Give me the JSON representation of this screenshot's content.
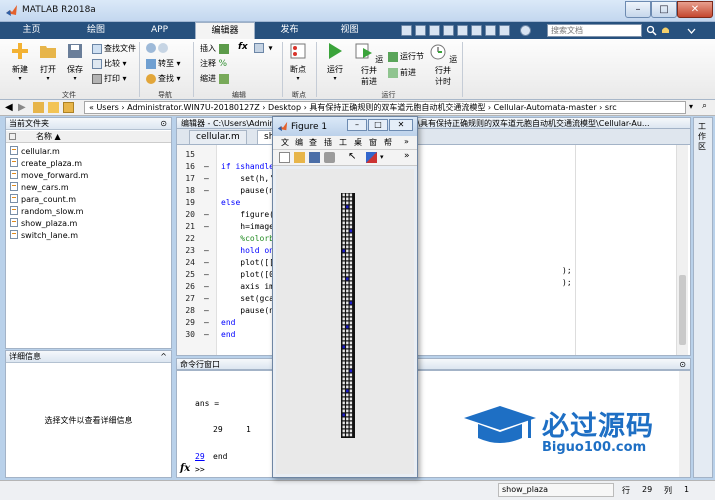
{
  "window": {
    "title": "MATLAB R2018a"
  },
  "tabs": [
    "主页",
    "绘图",
    "APP",
    "编辑器",
    "发布",
    "视图"
  ],
  "search": {
    "placeholder": "搜索文档"
  },
  "ribbon": {
    "new": "新建",
    "open": "打开",
    "save": "保存",
    "find_files": "查找文件",
    "compare": "比较",
    "print": "打印",
    "goto": "转至",
    "find": "查找",
    "insert": "插入",
    "comment": "注释",
    "indent": "缩进",
    "fx": "fx",
    "breakpoints": "断点",
    "run": "运行",
    "run_advance_l1": "运行并",
    "run_advance_l2": "前进",
    "run_section": "运行节",
    "advance": "前进",
    "run_time_l1": "运行并",
    "run_time_l2": "计时",
    "sections": [
      "文件",
      "导航",
      "编辑",
      "断点",
      "运行"
    ]
  },
  "address": {
    "path": "« Users › Administrator.WIN7U-20180127Z › Desktop › 具有保持正确规则的双车道元胞自动机交通流模型 › Cellular-Automata-master › src"
  },
  "folder_panel": {
    "title": "当前文件夹",
    "column": "名称 ▲",
    "files": [
      "cellular.m",
      "create_plaza.m",
      "move_forward.m",
      "new_cars.m",
      "para_count.m",
      "random_slow.m",
      "show_plaza.m",
      "switch_lane.m"
    ]
  },
  "detail_panel": {
    "title": "详细信息",
    "message": "选择文件以查看详细信息"
  },
  "editor": {
    "header": "编辑器 - C:\\Users\\Administrator.WIN7U-20180127Z\\Desktop\\具有保持正确规则的双车道元胞自动机交通流模型\\Cellular-Au...",
    "tabs": [
      "cellular.m",
      "sh"
    ],
    "lines": [
      {
        "n": "15",
        "dash": "",
        "code": ""
      },
      {
        "n": "16",
        "dash": "–",
        "code": "if ishandle("
      },
      {
        "n": "17",
        "dash": "–",
        "code": "    set(h,'C"
      },
      {
        "n": "18",
        "dash": "–",
        "code": "    pause(n)"
      },
      {
        "n": "19",
        "dash": "",
        "code": "else"
      },
      {
        "n": "20",
        "dash": "–",
        "code": "    figure("
      },
      {
        "n": "21",
        "dash": "–",
        "code": "    h=image"
      },
      {
        "n": "22",
        "dash": "",
        "code": "    %colorb"
      },
      {
        "n": "23",
        "dash": "–",
        "code": "    hold on"
      },
      {
        "n": "24",
        "dash": "–",
        "code": "    plot([["
      },
      {
        "n": "25",
        "dash": "–",
        "code": "    plot([0"
      },
      {
        "n": "26",
        "dash": "–",
        "code": "    axis im"
      },
      {
        "n": "27",
        "dash": "–",
        "code": "    set(gca"
      },
      {
        "n": "28",
        "dash": "–",
        "code": "    pause(n"
      },
      {
        "n": "29",
        "dash": "–",
        "code": "end"
      },
      {
        "n": "30",
        "dash": "–",
        "code": "end"
      }
    ],
    "line_tail_24": ");",
    "line_tail_25": ");"
  },
  "command_window": {
    "title": "命令行窗口",
    "ans": "ans =",
    "value_a": "29",
    "value_b": "1",
    "link": "29",
    "link_tail": "end",
    "fx": "fx",
    "prompt": ">>"
  },
  "workspace": {
    "label": "工作区"
  },
  "figure": {
    "title": "Figure 1",
    "menu": [
      "文",
      "编",
      "查",
      "插",
      "工",
      "桌",
      "窗",
      "帮"
    ]
  },
  "status": {
    "script": "show_plaza",
    "row_label": "行",
    "row": "29",
    "col_label": "列",
    "col": "1"
  },
  "watermark": {
    "title": "必过源码",
    "url": "Biguo100.com"
  },
  "colors": {
    "tabbar": "#27517e",
    "keyword": "#0000ff",
    "comment": "#228b22",
    "car": "#1f1fd0"
  }
}
